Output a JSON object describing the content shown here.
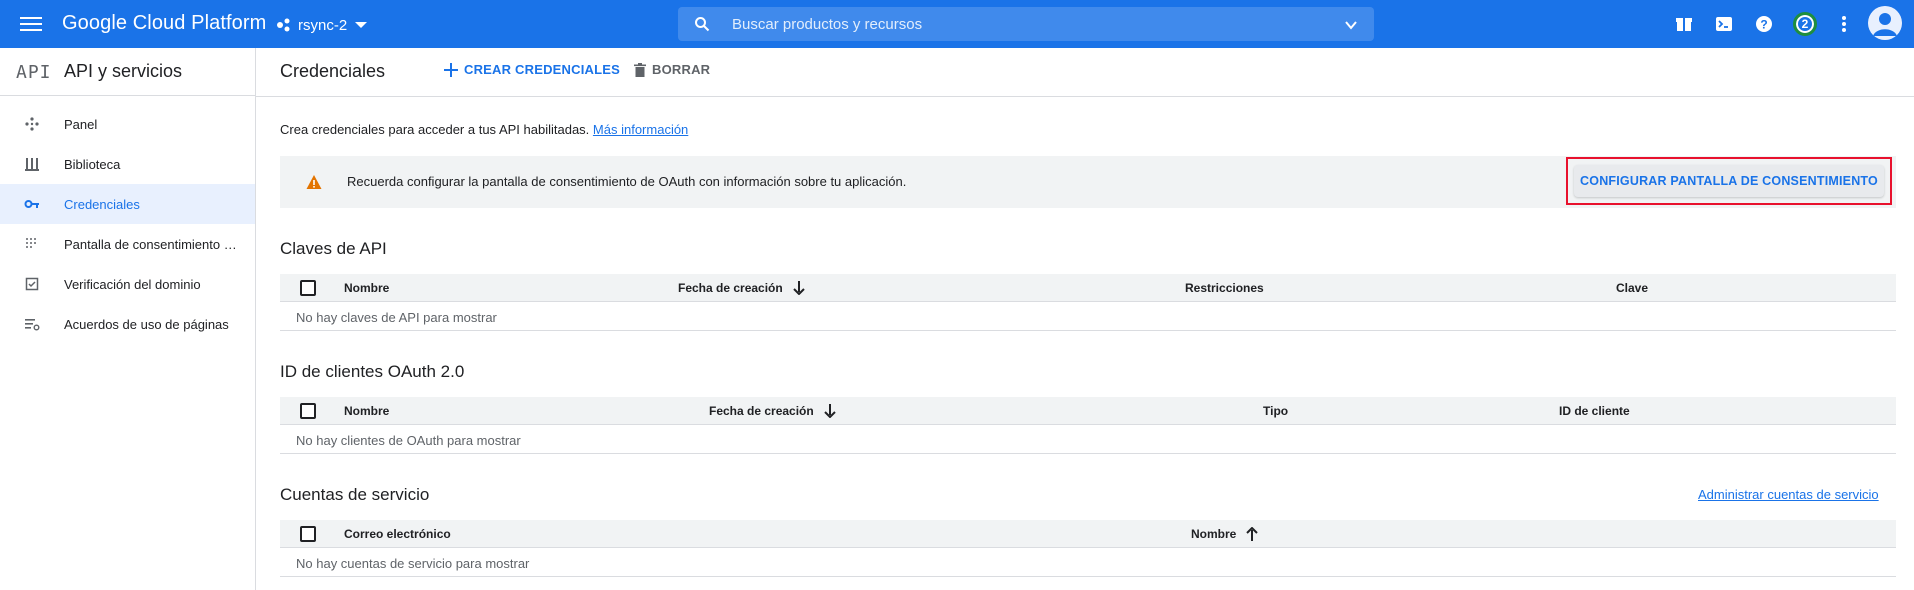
{
  "topbar": {
    "brand": "Google Cloud Platform",
    "project": "rsync-2",
    "search_placeholder": "Buscar productos y recursos",
    "notification_count": "2"
  },
  "sidenav": {
    "logo": "API",
    "title": "API y servicios",
    "items": [
      {
        "label": "Panel",
        "icon": "dashboard-icon"
      },
      {
        "label": "Biblioteca",
        "icon": "library-icon"
      },
      {
        "label": "Credenciales",
        "icon": "key-icon",
        "active": true
      },
      {
        "label": "Pantalla de consentimiento de OAuth",
        "icon": "consent-icon"
      },
      {
        "label": "Verificación del dominio",
        "icon": "domain-check-icon"
      },
      {
        "label": "Acuerdos de uso de páginas",
        "icon": "settings-list-icon"
      }
    ]
  },
  "page": {
    "title": "Credenciales",
    "create_label": "CREAR CREDENCIALES",
    "delete_label": "BORRAR",
    "intro_text": "Crea credenciales para acceder a tus API habilitadas.",
    "intro_link": "Más información",
    "alert_text": "Recuerda configurar la pantalla de consentimiento de OAuth con información sobre tu aplicación.",
    "alert_button": "CONFIGURAR PANTALLA DE CONSENTIMIENTO"
  },
  "api_keys": {
    "title": "Claves de API",
    "columns": [
      "Nombre",
      "Fecha de creación",
      "Restricciones",
      "Clave"
    ],
    "empty": "No hay claves de API para mostrar"
  },
  "oauth_clients": {
    "title": "ID de clientes OAuth 2.0",
    "columns": [
      "Nombre",
      "Fecha de creación",
      "Tipo",
      "ID de cliente"
    ],
    "empty": "No hay clientes de OAuth para mostrar"
  },
  "service_accounts": {
    "title": "Cuentas de servicio",
    "manage_link": "Administrar cuentas de servicio",
    "columns": [
      "Correo electrónico",
      "Nombre"
    ],
    "empty": "No hay cuentas de servicio para mostrar"
  },
  "colors": {
    "primary": "#1a73e8",
    "warning": "#e37400",
    "highlight": "#e8112d"
  }
}
